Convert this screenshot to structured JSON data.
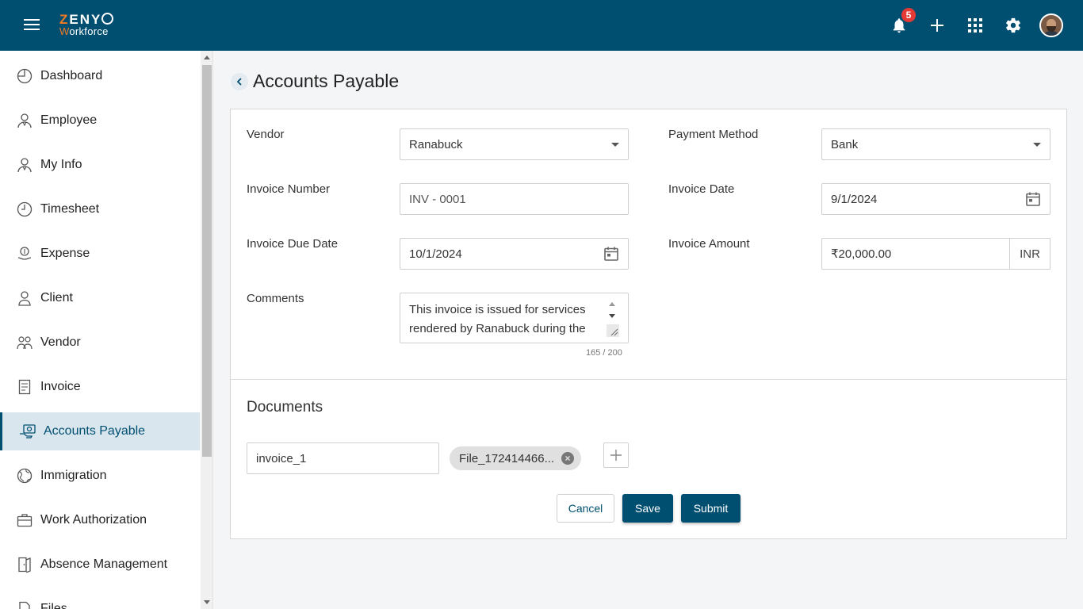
{
  "app": {
    "logo_line1_a": "Z",
    "logo_line1_b": "ENY",
    "logo_line2_a": "W",
    "logo_line2_b": "orkforce"
  },
  "header": {
    "notification_count": "5",
    "icons": [
      "menu-icon",
      "bell-icon",
      "plus-icon",
      "apps-grid-icon",
      "gear-icon",
      "avatar"
    ]
  },
  "sidebar": {
    "items": [
      {
        "label": "Dashboard",
        "icon": "dashboard-icon"
      },
      {
        "label": "Employee",
        "icon": "employee-icon"
      },
      {
        "label": "My Info",
        "icon": "my-info-icon"
      },
      {
        "label": "Timesheet",
        "icon": "clock-icon"
      },
      {
        "label": "Expense",
        "icon": "expense-icon"
      },
      {
        "label": "Client",
        "icon": "client-icon"
      },
      {
        "label": "Vendor",
        "icon": "vendor-icon"
      },
      {
        "label": "Invoice",
        "icon": "invoice-icon"
      },
      {
        "label": "Accounts Payable",
        "icon": "accounts-payable-icon",
        "active": true
      },
      {
        "label": "Immigration",
        "icon": "globe-icon"
      },
      {
        "label": "Work Authorization",
        "icon": "briefcase-icon"
      },
      {
        "label": "Absence Management",
        "icon": "door-exit-icon"
      },
      {
        "label": "Files",
        "icon": "files-icon"
      }
    ]
  },
  "page": {
    "title": "Accounts Payable"
  },
  "form": {
    "vendor_label": "Vendor",
    "vendor_value": "Ranabuck",
    "payment_method_label": "Payment Method",
    "payment_method_value": "Bank",
    "invoice_number_label": "Invoice Number",
    "invoice_number_value": "INV - 0001",
    "invoice_date_label": "Invoice Date",
    "invoice_date_value": "9/1/2024",
    "invoice_due_date_label": "Invoice Due Date",
    "invoice_due_date_value": "10/1/2024",
    "invoice_amount_label": "Invoice Amount",
    "invoice_amount_value": "₹20,000.00",
    "currency": "INR",
    "comments_label": "Comments",
    "comments_value": "This invoice is issued for services rendered by Ranabuck during the",
    "comments_counter": "165 / 200"
  },
  "documents": {
    "title": "Documents",
    "name_value": "invoice_1",
    "file_chip": "File_172414466..."
  },
  "actions": {
    "cancel": "Cancel",
    "save": "Save",
    "submit": "Submit"
  },
  "colors": {
    "brand": "#004f71",
    "accent": "#f07a26",
    "badge": "#e53935",
    "active_bg": "#d9e6ee"
  }
}
